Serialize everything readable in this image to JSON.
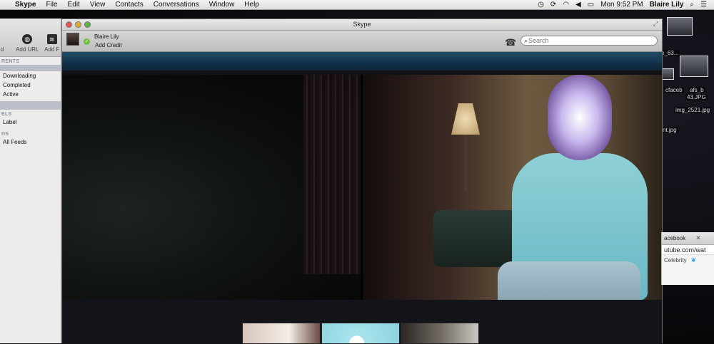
{
  "menubar": {
    "app": "Skype",
    "items": [
      "File",
      "Edit",
      "View",
      "Contacts",
      "Conversations",
      "Window",
      "Help"
    ],
    "clock": "Mon 9:52 PM",
    "user": "Blaire Lily",
    "icons": [
      "time-machine-icon",
      "sync-icon",
      "wifi-icon",
      "volume-icon",
      "battery-icon",
      "spotlight-icon",
      "list-icon"
    ]
  },
  "left_app": {
    "toolbar": {
      "add_label": "d",
      "add_url_label": "Add URL",
      "add_feed_label": "Add F"
    },
    "sections": {
      "torrents": "RENTS",
      "labels": "ELS",
      "feeds": "DS"
    },
    "items": {
      "downloading": "Downloading",
      "completed": "Completed",
      "active": "Active",
      "label": "Label",
      "all_feeds": "All Feeds"
    }
  },
  "skype": {
    "title": "Skype",
    "user_name": "Blaire Lily",
    "add_credit": "Add Credit",
    "search_placeholder": "Search"
  },
  "desktop": {
    "files": {
      "f1": "e_63...",
      "f2": "cfaceb",
      "f3": "afs_b",
      "f4": "43.JPG",
      "f5": "img_2521.jpg",
      "f6": "nt.jpg"
    }
  },
  "browser": {
    "tab": "acebook",
    "url": "utube.com/wat",
    "row": "Celebrity"
  }
}
